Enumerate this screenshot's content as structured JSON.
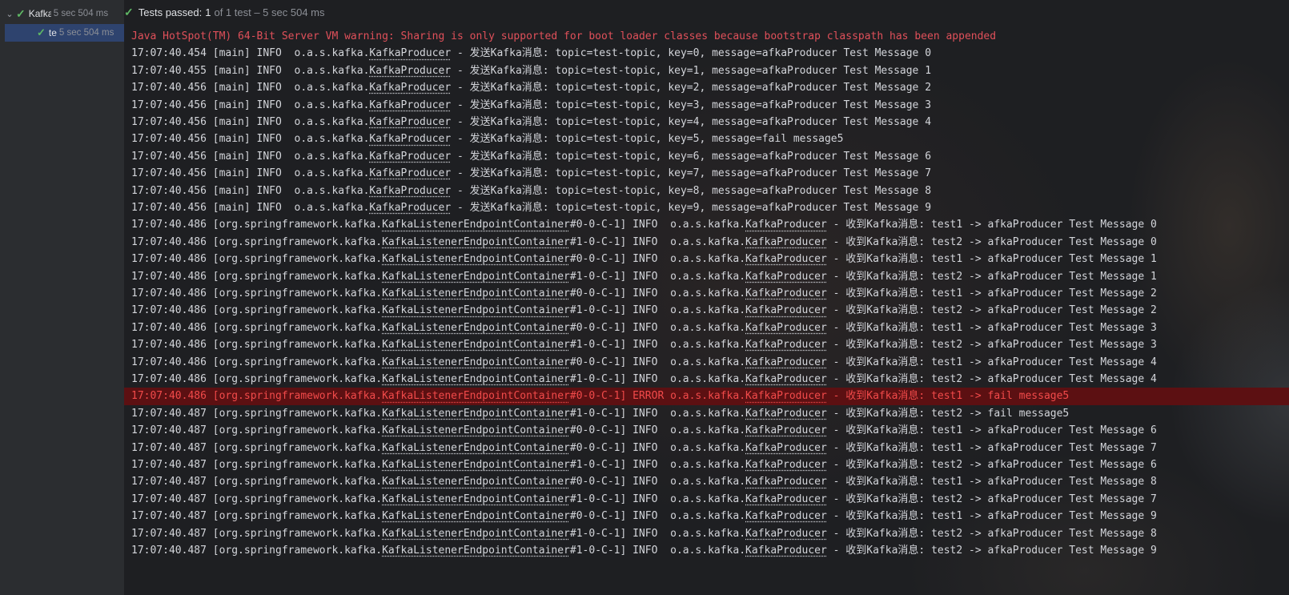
{
  "tree": {
    "root": {
      "name": "Kafka",
      "duration": "5 sec 504 ms"
    },
    "child": {
      "name": "te",
      "duration": "5 sec 504 ms"
    }
  },
  "status": {
    "passed_label": "Tests passed:",
    "passed_count": "1",
    "detail": "of 1 test – 5 sec 504 ms"
  },
  "colors": {
    "pass": "#5fb865",
    "error_bg": "#5c1012",
    "error_text": "#f24a4a",
    "warn_text": "#e0505a"
  },
  "console": {
    "lines": [
      {
        "type": "warn",
        "segments": [
          {
            "text": "Java HotSpot(TM) 64-Bit Server VM warning: Sharing is only supported for boot loader classes because bootstrap classpath has been appended"
          }
        ]
      },
      {
        "type": "info",
        "segments": [
          {
            "text": "17:07:40.454 [main] INFO  o.a.s.kafka."
          },
          {
            "text": "KafkaProducer",
            "u": true
          },
          {
            "text": " - 发送Kafka消息: topic=test-topic, key=0, message=afkaProducer Test Message 0"
          }
        ]
      },
      {
        "type": "info",
        "segments": [
          {
            "text": "17:07:40.455 [main] INFO  o.a.s.kafka."
          },
          {
            "text": "KafkaProducer",
            "u": true
          },
          {
            "text": " - 发送Kafka消息: topic=test-topic, key=1, message=afkaProducer Test Message 1"
          }
        ]
      },
      {
        "type": "info",
        "segments": [
          {
            "text": "17:07:40.456 [main] INFO  o.a.s.kafka."
          },
          {
            "text": "KafkaProducer",
            "u": true
          },
          {
            "text": " - 发送Kafka消息: topic=test-topic, key=2, message=afkaProducer Test Message 2"
          }
        ]
      },
      {
        "type": "info",
        "segments": [
          {
            "text": "17:07:40.456 [main] INFO  o.a.s.kafka."
          },
          {
            "text": "KafkaProducer",
            "u": true
          },
          {
            "text": " - 发送Kafka消息: topic=test-topic, key=3, message=afkaProducer Test Message 3"
          }
        ]
      },
      {
        "type": "info",
        "segments": [
          {
            "text": "17:07:40.456 [main] INFO  o.a.s.kafka."
          },
          {
            "text": "KafkaProducer",
            "u": true
          },
          {
            "text": " - 发送Kafka消息: topic=test-topic, key=4, message=afkaProducer Test Message 4"
          }
        ]
      },
      {
        "type": "info",
        "segments": [
          {
            "text": "17:07:40.456 [main] INFO  o.a.s.kafka."
          },
          {
            "text": "KafkaProducer",
            "u": true
          },
          {
            "text": " - 发送Kafka消息: topic=test-topic, key=5, message=fail message5"
          }
        ]
      },
      {
        "type": "info",
        "segments": [
          {
            "text": "17:07:40.456 [main] INFO  o.a.s.kafka."
          },
          {
            "text": "KafkaProducer",
            "u": true
          },
          {
            "text": " - 发送Kafka消息: topic=test-topic, key=6, message=afkaProducer Test Message 6"
          }
        ]
      },
      {
        "type": "info",
        "segments": [
          {
            "text": "17:07:40.456 [main] INFO  o.a.s.kafka."
          },
          {
            "text": "KafkaProducer",
            "u": true
          },
          {
            "text": " - 发送Kafka消息: topic=test-topic, key=7, message=afkaProducer Test Message 7"
          }
        ]
      },
      {
        "type": "info",
        "segments": [
          {
            "text": "17:07:40.456 [main] INFO  o.a.s.kafka."
          },
          {
            "text": "KafkaProducer",
            "u": true
          },
          {
            "text": " - 发送Kafka消息: topic=test-topic, key=8, message=afkaProducer Test Message 8"
          }
        ]
      },
      {
        "type": "info",
        "segments": [
          {
            "text": "17:07:40.456 [main] INFO  o.a.s.kafka."
          },
          {
            "text": "KafkaProducer",
            "u": true
          },
          {
            "text": " - 发送Kafka消息: topic=test-topic, key=9, message=afkaProducer Test Message 9"
          }
        ]
      },
      {
        "type": "info",
        "segments": [
          {
            "text": "17:07:40.486 [org.springframework.kafka."
          },
          {
            "text": "KafkaListenerEndpointContainer",
            "u": true
          },
          {
            "text": "#0-0-C-1] INFO  o.a.s.kafka."
          },
          {
            "text": "KafkaProducer",
            "u": true
          },
          {
            "text": " - 收到Kafka消息: test1 -> afkaProducer Test Message 0"
          }
        ]
      },
      {
        "type": "info",
        "segments": [
          {
            "text": "17:07:40.486 [org.springframework.kafka."
          },
          {
            "text": "KafkaListenerEndpointContainer",
            "u": true
          },
          {
            "text": "#1-0-C-1] INFO  o.a.s.kafka."
          },
          {
            "text": "KafkaProducer",
            "u": true
          },
          {
            "text": " - 收到Kafka消息: test2 -> afkaProducer Test Message 0"
          }
        ]
      },
      {
        "type": "info",
        "segments": [
          {
            "text": "17:07:40.486 [org.springframework.kafka."
          },
          {
            "text": "KafkaListenerEndpointContainer",
            "u": true
          },
          {
            "text": "#0-0-C-1] INFO  o.a.s.kafka."
          },
          {
            "text": "KafkaProducer",
            "u": true
          },
          {
            "text": " - 收到Kafka消息: test1 -> afkaProducer Test Message 1"
          }
        ]
      },
      {
        "type": "info",
        "segments": [
          {
            "text": "17:07:40.486 [org.springframework.kafka."
          },
          {
            "text": "KafkaListenerEndpointContainer",
            "u": true
          },
          {
            "text": "#1-0-C-1] INFO  o.a.s.kafka."
          },
          {
            "text": "KafkaProducer",
            "u": true
          },
          {
            "text": " - 收到Kafka消息: test2 -> afkaProducer Test Message 1"
          }
        ]
      },
      {
        "type": "info",
        "segments": [
          {
            "text": "17:07:40.486 [org.springframework.kafka."
          },
          {
            "text": "KafkaListenerEndpointContainer",
            "u": true
          },
          {
            "text": "#0-0-C-1] INFO  o.a.s.kafka."
          },
          {
            "text": "KafkaProducer",
            "u": true
          },
          {
            "text": " - 收到Kafka消息: test1 -> afkaProducer Test Message 2"
          }
        ]
      },
      {
        "type": "info",
        "segments": [
          {
            "text": "17:07:40.486 [org.springframework.kafka."
          },
          {
            "text": "KafkaListenerEndpointContainer",
            "u": true
          },
          {
            "text": "#1-0-C-1] INFO  o.a.s.kafka."
          },
          {
            "text": "KafkaProducer",
            "u": true
          },
          {
            "text": " - 收到Kafka消息: test2 -> afkaProducer Test Message 2"
          }
        ]
      },
      {
        "type": "info",
        "segments": [
          {
            "text": "17:07:40.486 [org.springframework.kafka."
          },
          {
            "text": "KafkaListenerEndpointContainer",
            "u": true
          },
          {
            "text": "#0-0-C-1] INFO  o.a.s.kafka."
          },
          {
            "text": "KafkaProducer",
            "u": true
          },
          {
            "text": " - 收到Kafka消息: test1 -> afkaProducer Test Message 3"
          }
        ]
      },
      {
        "type": "info",
        "segments": [
          {
            "text": "17:07:40.486 [org.springframework.kafka."
          },
          {
            "text": "KafkaListenerEndpointContainer",
            "u": true
          },
          {
            "text": "#1-0-C-1] INFO  o.a.s.kafka."
          },
          {
            "text": "KafkaProducer",
            "u": true
          },
          {
            "text": " - 收到Kafka消息: test2 -> afkaProducer Test Message 3"
          }
        ]
      },
      {
        "type": "info",
        "segments": [
          {
            "text": "17:07:40.486 [org.springframework.kafka."
          },
          {
            "text": "KafkaListenerEndpointContainer",
            "u": true
          },
          {
            "text": "#0-0-C-1] INFO  o.a.s.kafka."
          },
          {
            "text": "KafkaProducer",
            "u": true
          },
          {
            "text": " - 收到Kafka消息: test1 -> afkaProducer Test Message 4"
          }
        ]
      },
      {
        "type": "info",
        "segments": [
          {
            "text": "17:07:40.486 [org.springframework.kafka."
          },
          {
            "text": "KafkaListenerEndpointContainer",
            "u": true
          },
          {
            "text": "#1-0-C-1] INFO  o.a.s.kafka."
          },
          {
            "text": "KafkaProducer",
            "u": true
          },
          {
            "text": " - 收到Kafka消息: test2 -> afkaProducer Test Message 4"
          }
        ]
      },
      {
        "type": "error",
        "segments": [
          {
            "text": "17:07:40.486 [org.springframework.kafka."
          },
          {
            "text": "KafkaListenerEndpointContainer",
            "u": true
          },
          {
            "text": "#0-0-C-1] ERROR o.a.s.kafka."
          },
          {
            "text": "KafkaProducer",
            "u": true
          },
          {
            "text": " - 收到Kafka消息: test1 -> fail message5"
          }
        ]
      },
      {
        "type": "info",
        "segments": [
          {
            "text": "17:07:40.487 [org.springframework.kafka."
          },
          {
            "text": "KafkaListenerEndpointContainer",
            "u": true
          },
          {
            "text": "#1-0-C-1] INFO  o.a.s.kafka."
          },
          {
            "text": "KafkaProducer",
            "u": true
          },
          {
            "text": " - 收到Kafka消息: test2 -> fail message5"
          }
        ]
      },
      {
        "type": "info",
        "segments": [
          {
            "text": "17:07:40.487 [org.springframework.kafka."
          },
          {
            "text": "KafkaListenerEndpointContainer",
            "u": true
          },
          {
            "text": "#0-0-C-1] INFO  o.a.s.kafka."
          },
          {
            "text": "KafkaProducer",
            "u": true
          },
          {
            "text": " - 收到Kafka消息: test1 -> afkaProducer Test Message 6"
          }
        ]
      },
      {
        "type": "info",
        "segments": [
          {
            "text": "17:07:40.487 [org.springframework.kafka."
          },
          {
            "text": "KafkaListenerEndpointContainer",
            "u": true
          },
          {
            "text": "#0-0-C-1] INFO  o.a.s.kafka."
          },
          {
            "text": "KafkaProducer",
            "u": true
          },
          {
            "text": " - 收到Kafka消息: test1 -> afkaProducer Test Message 7"
          }
        ]
      },
      {
        "type": "info",
        "segments": [
          {
            "text": "17:07:40.487 [org.springframework.kafka."
          },
          {
            "text": "KafkaListenerEndpointContainer",
            "u": true
          },
          {
            "text": "#1-0-C-1] INFO  o.a.s.kafka."
          },
          {
            "text": "KafkaProducer",
            "u": true
          },
          {
            "text": " - 收到Kafka消息: test2 -> afkaProducer Test Message 6"
          }
        ]
      },
      {
        "type": "info",
        "segments": [
          {
            "text": "17:07:40.487 [org.springframework.kafka."
          },
          {
            "text": "KafkaListenerEndpointContainer",
            "u": true
          },
          {
            "text": "#0-0-C-1] INFO  o.a.s.kafka."
          },
          {
            "text": "KafkaProducer",
            "u": true
          },
          {
            "text": " - 收到Kafka消息: test1 -> afkaProducer Test Message 8"
          }
        ]
      },
      {
        "type": "info",
        "segments": [
          {
            "text": "17:07:40.487 [org.springframework.kafka."
          },
          {
            "text": "KafkaListenerEndpointContainer",
            "u": true
          },
          {
            "text": "#1-0-C-1] INFO  o.a.s.kafka."
          },
          {
            "text": "KafkaProducer",
            "u": true
          },
          {
            "text": " - 收到Kafka消息: test2 -> afkaProducer Test Message 7"
          }
        ]
      },
      {
        "type": "info",
        "segments": [
          {
            "text": "17:07:40.487 [org.springframework.kafka."
          },
          {
            "text": "KafkaListenerEndpointContainer",
            "u": true
          },
          {
            "text": "#0-0-C-1] INFO  o.a.s.kafka."
          },
          {
            "text": "KafkaProducer",
            "u": true
          },
          {
            "text": " - 收到Kafka消息: test1 -> afkaProducer Test Message 9"
          }
        ]
      },
      {
        "type": "info",
        "segments": [
          {
            "text": "17:07:40.487 [org.springframework.kafka."
          },
          {
            "text": "KafkaListenerEndpointContainer",
            "u": true
          },
          {
            "text": "#1-0-C-1] INFO  o.a.s.kafka."
          },
          {
            "text": "KafkaProducer",
            "u": true
          },
          {
            "text": " - 收到Kafka消息: test2 -> afkaProducer Test Message 8"
          }
        ]
      },
      {
        "type": "info",
        "segments": [
          {
            "text": "17:07:40.487 [org.springframework.kafka."
          },
          {
            "text": "KafkaListenerEndpointContainer",
            "u": true
          },
          {
            "text": "#1-0-C-1] INFO  o.a.s.kafka."
          },
          {
            "text": "KafkaProducer",
            "u": true
          },
          {
            "text": " - 收到Kafka消息: test2 -> afkaProducer Test Message 9"
          }
        ]
      }
    ]
  }
}
